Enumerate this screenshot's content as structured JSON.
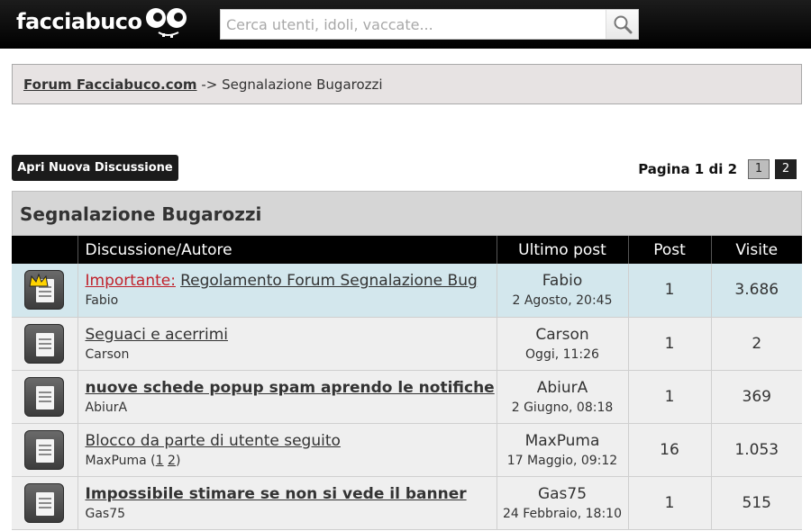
{
  "header": {
    "logo_text": "facciabuco",
    "logo_icon": "cartoon-eyes-mascot",
    "search": {
      "placeholder": "Cerca utenti, idoli, vaccate...",
      "icon": "magnifier-icon"
    }
  },
  "breadcrumb": {
    "root_label": "Forum Facciabuco.com",
    "separator": " -> ",
    "current": "Segnalazione Bugarozzi"
  },
  "toolbar": {
    "new_topic_label": "Apri Nuova Discussione"
  },
  "pagination": {
    "label": "Pagina 1 di 2",
    "pages": [
      "1",
      "2"
    ],
    "current": "1"
  },
  "forum": {
    "title": "Segnalazione Bugarozzi",
    "columns": {
      "topic": "Discussione/Autore",
      "last_post": "Ultimo post",
      "posts": "Post",
      "views": "Visite"
    },
    "topics": [
      {
        "icon": "sticky-crown-document-icon",
        "prefix": "Importante:",
        "title": "Regolamento Forum Segnalazione Bug",
        "author": "Fabio",
        "last_user": "Fabio",
        "last_date": "2 Agosto, 20:45",
        "posts": "1",
        "views": "3.686",
        "sticky": true,
        "bold": false
      },
      {
        "icon": "document-icon",
        "prefix": "",
        "title": "Seguaci e acerrimi",
        "author": "Carson",
        "last_user": "Carson",
        "last_date": "Oggi, 11:26",
        "posts": "1",
        "views": "2",
        "bold": false
      },
      {
        "icon": "document-icon",
        "prefix": "",
        "title": "nuove schede popup spam aprendo le notifiche",
        "author": "AbiurA",
        "last_user": "AbiurA",
        "last_date": "2 Giugno, 08:18",
        "posts": "1",
        "views": "369",
        "bold": true
      },
      {
        "icon": "document-icon",
        "prefix": "",
        "title": "Blocco da parte di utente seguito",
        "author": "MaxPuma",
        "author_pages": [
          "1",
          "2"
        ],
        "last_user": "MaxPuma",
        "last_date": "17 Maggio, 09:12",
        "posts": "16",
        "views": "1.053",
        "bold": false
      },
      {
        "icon": "document-icon",
        "prefix": "",
        "title": "Impossibile stimare se non si vede il banner",
        "author": "Gas75",
        "last_user": "Gas75",
        "last_date": "24 Febbraio, 18:10",
        "posts": "1",
        "views": "515",
        "bold": true
      }
    ]
  },
  "colors": {
    "topbar": "#000000",
    "sticky_row": "#d3e7ed",
    "row": "#efefef",
    "prefix_red": "#c0212b",
    "breadcrumb_bg": "#e7e3e3"
  }
}
